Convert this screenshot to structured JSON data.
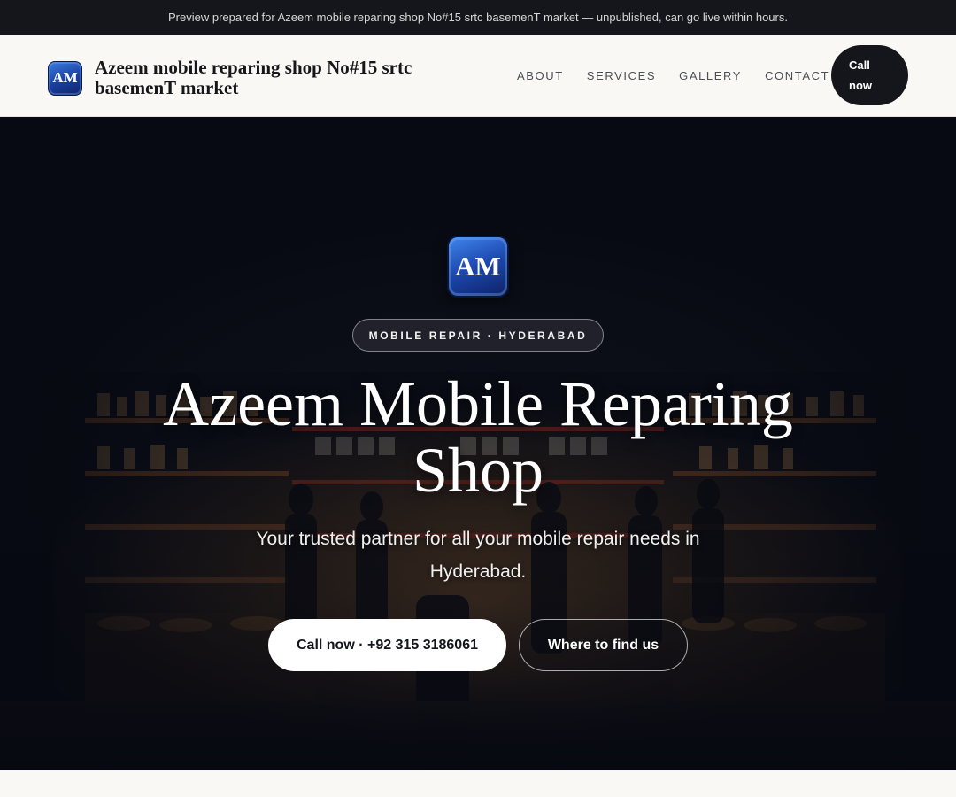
{
  "preview_banner": {
    "text": "Preview prepared for Azeem mobile reparing shop No#15 srtc basemenT market — unpublished, can go live within hours."
  },
  "header": {
    "logo_text": "AM",
    "brand_name": "Azeem mobile reparing shop No#15 srtc basemenT market",
    "nav": [
      {
        "label": "ABOUT"
      },
      {
        "label": "SERVICES"
      },
      {
        "label": "GALLERY"
      },
      {
        "label": "CONTACT"
      }
    ],
    "call_button": "Call now"
  },
  "hero": {
    "logo_text": "AM",
    "tag": "MOBILE REPAIR · HYDERABAD",
    "title": "Azeem Mobile Reparing Shop",
    "subtitle": "Your trusted partner for all your mobile repair needs in Hyderabad.",
    "primary_cta": "Call now · +92 315 3186061",
    "secondary_cta": "Where to find us"
  },
  "colors": {
    "banner_bg": "#14161b",
    "header_bg": "#faf8f4",
    "accent_dark": "#14161b",
    "logo_blue": "#1c47ad"
  }
}
